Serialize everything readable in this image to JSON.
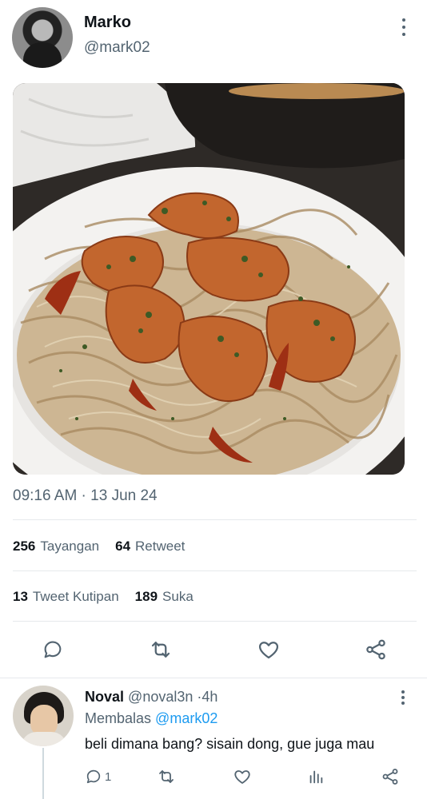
{
  "post": {
    "author_name": "Marko",
    "author_handle": "@mark02",
    "timestamp": "09:16 AM · 13 Jun 24",
    "photo_alt": "photo",
    "stats": [
      {
        "count": "256",
        "label": "Tayangan"
      },
      {
        "count": "64",
        "label": "Retweet"
      }
    ],
    "stats2": [
      {
        "count": "13",
        "label": "Tweet Kutipan"
      },
      {
        "count": "189",
        "label": "Suka"
      }
    ]
  },
  "reply": {
    "name": "Noval",
    "handle": "@noval3n",
    "separator": "·",
    "time": "4h",
    "replying_prefix": "Membalas",
    "replying_mention": "@mark02",
    "text": "beli dimana bang? sisain dong, gue juga mau",
    "reply_count": "1"
  },
  "icons": {
    "reply": "reply-icon",
    "retweet": "retweet-icon",
    "like": "heart-icon",
    "share": "share-icon",
    "views": "views-icon",
    "more": "more-vertical-icon"
  },
  "colors": {
    "accent": "#1d9bf0",
    "icon_gray": "#536471",
    "text": "#0f1419",
    "divider": "#e6e9ec"
  }
}
